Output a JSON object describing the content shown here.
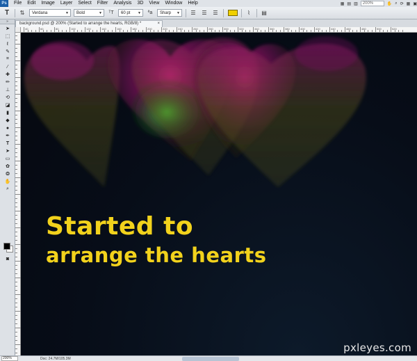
{
  "menubar": {
    "logo": "Ps",
    "items": [
      "File",
      "Edit",
      "Image",
      "Layer",
      "Select",
      "Filter",
      "Analysis",
      "3D",
      "View",
      "Window",
      "Help"
    ],
    "zoom_value": "200%"
  },
  "options": {
    "tool_glyph": "T",
    "font_family": "Verdana",
    "font_style": "Bold",
    "font_size": "60 pt",
    "antialias": "Sharp",
    "text_color": "#f0d000"
  },
  "document": {
    "tab_title": "background.psd @ 200% (Started to      arrange the hearts, RGB/8) *",
    "ruler_labels": [
      "40",
      "60",
      "80",
      "100",
      "120",
      "140",
      "160",
      "180",
      "200",
      "220",
      "240",
      "260",
      "280",
      "300",
      "320",
      "340",
      "360",
      "380",
      "400",
      "420",
      "440",
      "460",
      "480",
      "500",
      "520"
    ]
  },
  "canvas": {
    "line1": "Started to",
    "line2": "arrange the hearts",
    "watermark": "pxleyes.com",
    "background_color": "#070d18",
    "heart_colors": [
      "#c0107a",
      "#3fa83a",
      "#7a7a10"
    ]
  },
  "status": {
    "zoom": "200%",
    "doc_size": "Doc: 24.7M/105.3M"
  }
}
